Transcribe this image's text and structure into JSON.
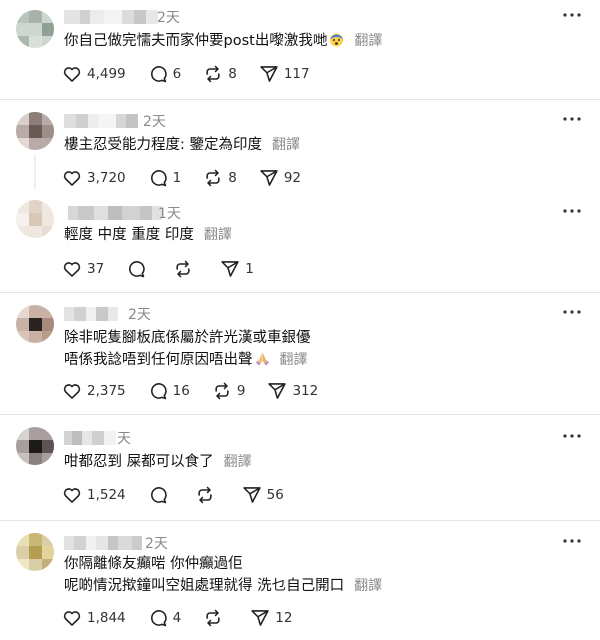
{
  "ui": {
    "translate_label": "翻譯"
  },
  "comments": [
    {
      "time": "2天",
      "text_lines": [
        "你自己做完懦夫而家仲要post出嚟激我哋"
      ],
      "likes": "4,499",
      "replies": "6",
      "reposts": "8",
      "shares": "117"
    },
    {
      "time": "2天",
      "text_lines": [
        "樓主忍受能力程度: 鑒定為印度"
      ],
      "likes": "3,720",
      "replies": "1",
      "reposts": "8",
      "shares": "92"
    },
    {
      "time": "1天",
      "text_lines": [
        "輕度 中度 重度 印度"
      ],
      "likes": "37",
      "replies": "",
      "reposts": "",
      "shares": "1"
    },
    {
      "time": "2天",
      "text_lines": [
        "除非呢隻腳板底係屬於許光漢或車銀優",
        "唔係我諗唔到任何原因唔出聲"
      ],
      "likes": "2,375",
      "replies": "16",
      "reposts": "9",
      "shares": "312"
    },
    {
      "time": "天",
      "text_lines": [
        "咁都忍到 屎都可以食了"
      ],
      "likes": "1,524",
      "replies": "",
      "reposts": "",
      "shares": "56"
    },
    {
      "time": "2天",
      "text_lines": [
        "你隔離條友癲啱 你仲癲過佢",
        "呢啲情況揿鐘叫空姐處理就得 洗乜自己開口"
      ],
      "likes": "1,844",
      "replies": "4",
      "reposts": "",
      "shares": "12"
    }
  ],
  "icons": {
    "like": "heart-icon",
    "reply": "comment-bubble-icon",
    "repost": "repost-arrows-icon",
    "share": "send-paper-plane-icon",
    "more": "more-options-icon"
  },
  "colors": {
    "text": "#111111",
    "muted": "#8a8a8a",
    "divider": "#e6e6e6"
  }
}
